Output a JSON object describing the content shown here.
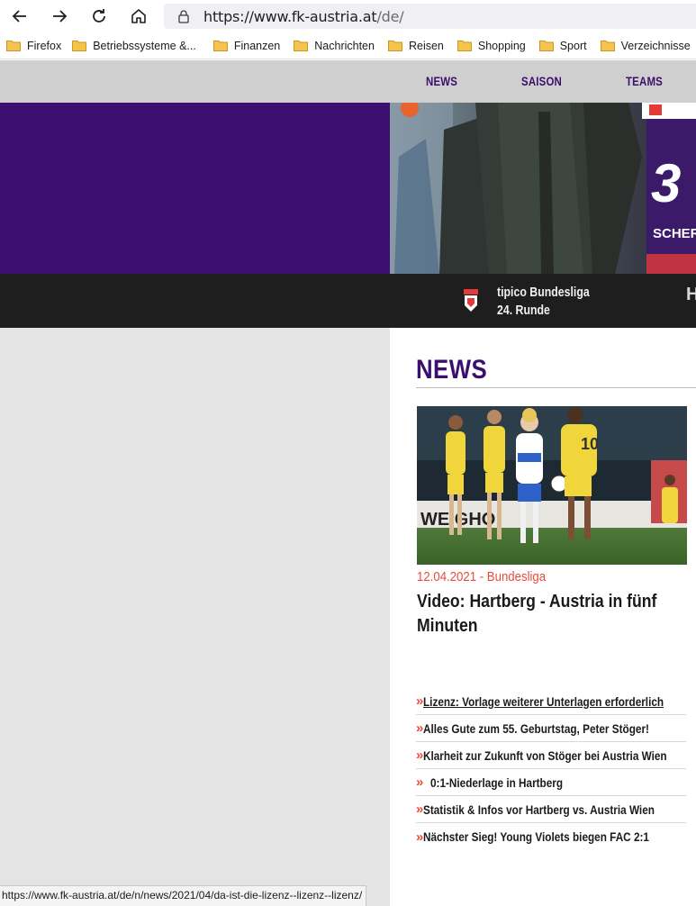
{
  "browser": {
    "url_host": "https://www.fk-austria.at",
    "url_path": "/de/",
    "bookmarks": [
      "Firefox",
      "Betriebssysteme &...",
      "Finanzen",
      "Nachrichten",
      "Reisen",
      "Shopping",
      "Sport",
      "Verzeichnisse"
    ],
    "status_url": "https://www.fk-austria.at/de/n/news/2021/04/da-ist-die-lizenz--lizenz--lizenz/"
  },
  "nav": {
    "items": [
      "NEWS",
      "SAISON",
      "TEAMS"
    ]
  },
  "ticker": {
    "league": "tipico Bundesliga",
    "round": "24. Runde",
    "next": "H"
  },
  "news": {
    "heading": "NEWS",
    "featured": {
      "meta": "12.04.2021 - Bundesliga",
      "title": "Video: Hartberg - Austria in fünf Minuten"
    },
    "list": [
      "Lizenz: Vorlage weiterer Unterlagen erforderlich",
      "Alles Gute zum 55. Geburtstag, Peter Stöger!",
      "Klarheit zur Zukunft von Stöger bei Austria Wien",
      "0:1-Niederlage in Hartberg",
      "Statistik & Infos vor Hartberg vs. Austria Wien",
      "Nächster Sieg! Young Violets biegen FAC 2:1"
    ]
  },
  "colors": {
    "accent_purple": "#3c0f6e",
    "accent_red": "#e84c3d"
  }
}
